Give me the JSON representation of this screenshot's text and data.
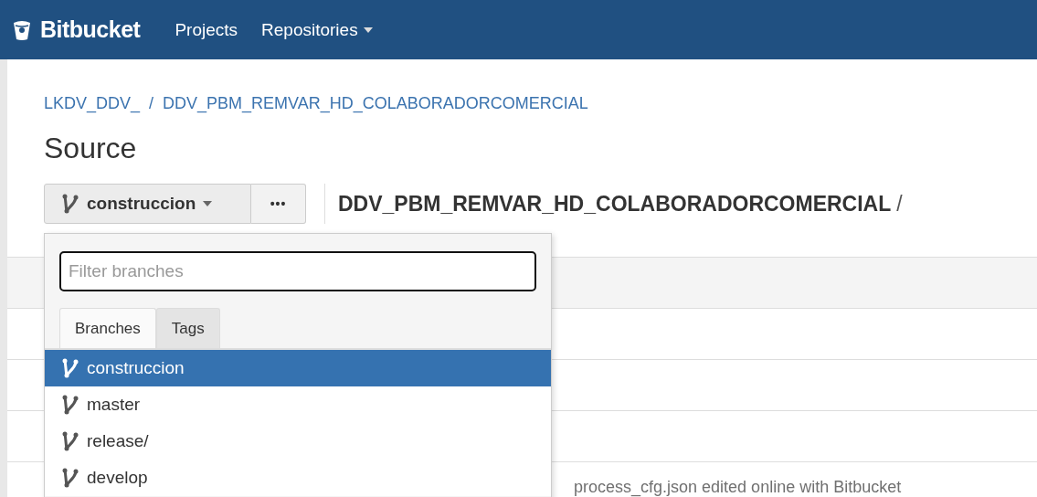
{
  "navbar": {
    "brand": "Bitbucket",
    "items": [
      {
        "label": "Projects",
        "has_menu": false
      },
      {
        "label": "Repositories",
        "has_menu": true
      }
    ]
  },
  "breadcrumb": [
    "LKDV_DDV_",
    "DDV_PBM_REMVAR_HD_COLABORADORCOMERCIAL"
  ],
  "breadcrumb_separator": "/",
  "page_title": "Source",
  "toolbar": {
    "branch": "construccion",
    "more": "•••",
    "path": "DDV_PBM_REMVAR_HD_COLABORADORCOMERCIAL",
    "path_separator": "/"
  },
  "branch_menu": {
    "filter": {
      "placeholder": "Filter branches"
    },
    "tabs": [
      {
        "label": "Branches",
        "selected": true
      },
      {
        "label": "Tags",
        "selected": false
      }
    ],
    "items": [
      {
        "name": "construccion",
        "selected": true
      },
      {
        "name": "master",
        "selected": false
      },
      {
        "name": "release/",
        "selected": false
      },
      {
        "name": "develop",
        "selected": false
      }
    ]
  },
  "table": {
    "rows": [
      {
        "message": ""
      },
      {
        "message": ""
      },
      {
        "message": ""
      },
      {
        "message": "process_cfg.json edited online with Bitbucket"
      }
    ]
  }
}
